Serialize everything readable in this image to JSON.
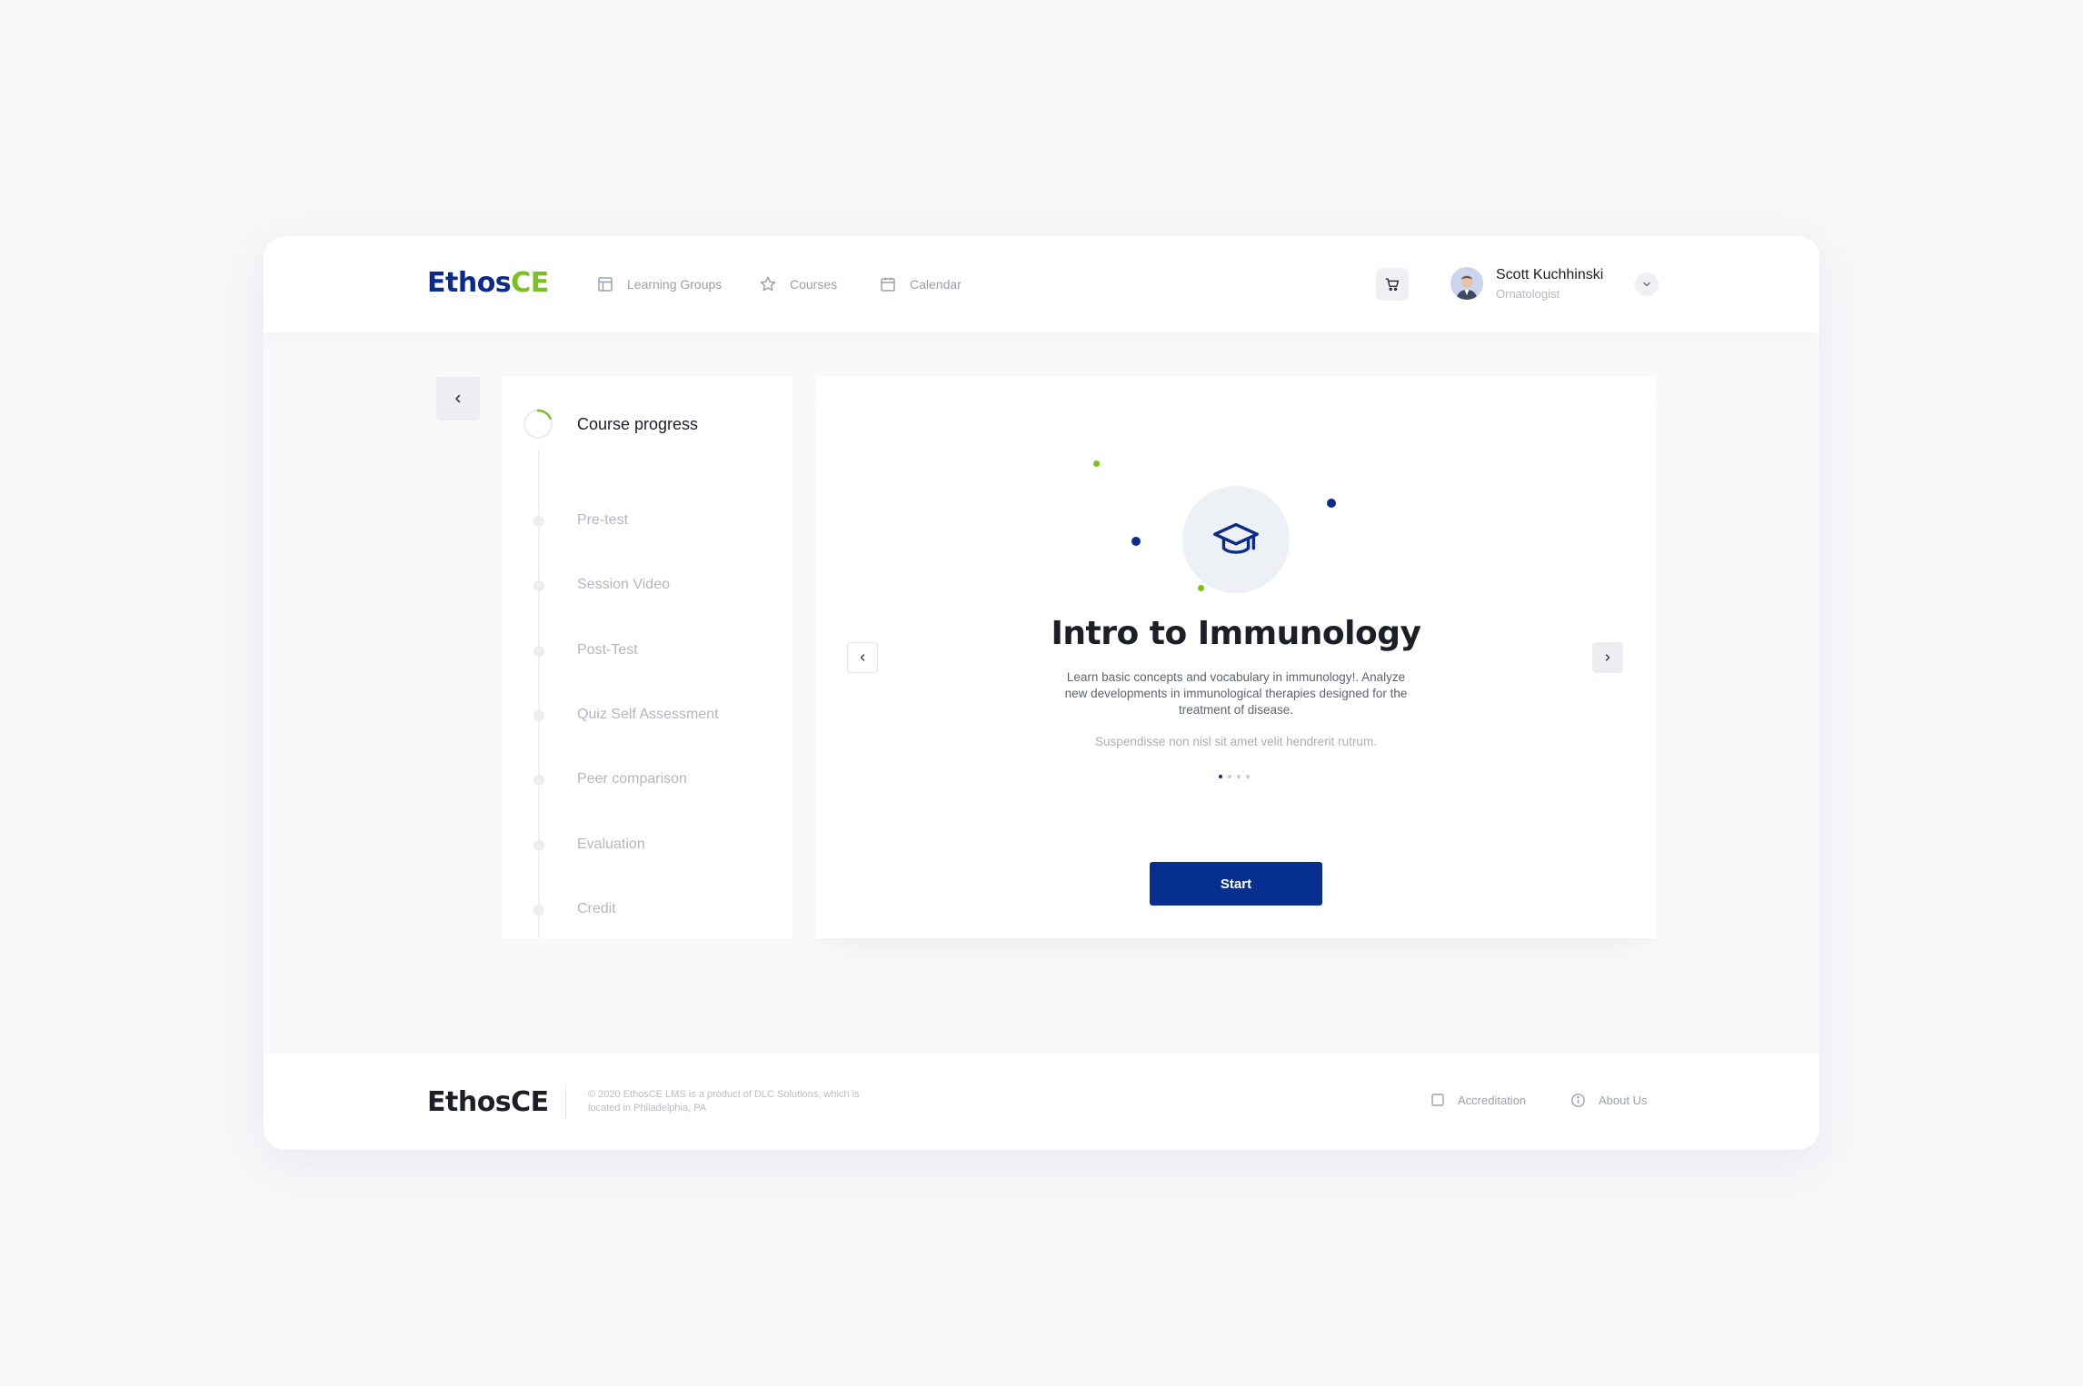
{
  "colors": {
    "brand_blue": "#0b2b8c",
    "brand_green": "#7cc122",
    "button_blue": "#062f8f",
    "muted_text": "#9aa0ab"
  },
  "header": {
    "logo_part1": "Ethos",
    "logo_part2": "CE",
    "nav": [
      {
        "label": "Learning Groups",
        "icon": "layout-icon"
      },
      {
        "label": "Courses",
        "icon": "star-icon"
      },
      {
        "label": "Calendar",
        "icon": "calendar-icon"
      }
    ],
    "cart_icon": "cart-icon",
    "user": {
      "name": "Scott Kuchhinski",
      "role": "Ornatologist"
    }
  },
  "sidebar": {
    "title": "Course progress",
    "progress_fraction": 0.18,
    "steps": [
      {
        "label": "Pre-test"
      },
      {
        "label": "Session Video"
      },
      {
        "label": "Post-Test"
      },
      {
        "label": "Quiz Self Assessment"
      },
      {
        "label": "Peer comparison"
      },
      {
        "label": "Evaluation"
      },
      {
        "label": "Credit"
      }
    ]
  },
  "course": {
    "icon": "graduation-cap-icon",
    "title": "Intro to Immunology",
    "description": "Learn basic concepts and vocabulary in immunology!. Analyze new developments in immunological therapies designed for the treatment of disease.",
    "note": "Suspendisse non nisl sit amet velit hendrerit rutrum.",
    "pager_total": 4,
    "pager_active": 1,
    "start_label": "Start"
  },
  "footer": {
    "logo": "EthosCE",
    "copyright": "© 2020 EthosCE LMS is a product of DLC Solutions, which is located in Philadelphia, PA",
    "links": [
      {
        "label": "Accreditation",
        "icon": "checkbox-icon"
      },
      {
        "label": "About Us",
        "icon": "info-icon"
      }
    ]
  }
}
